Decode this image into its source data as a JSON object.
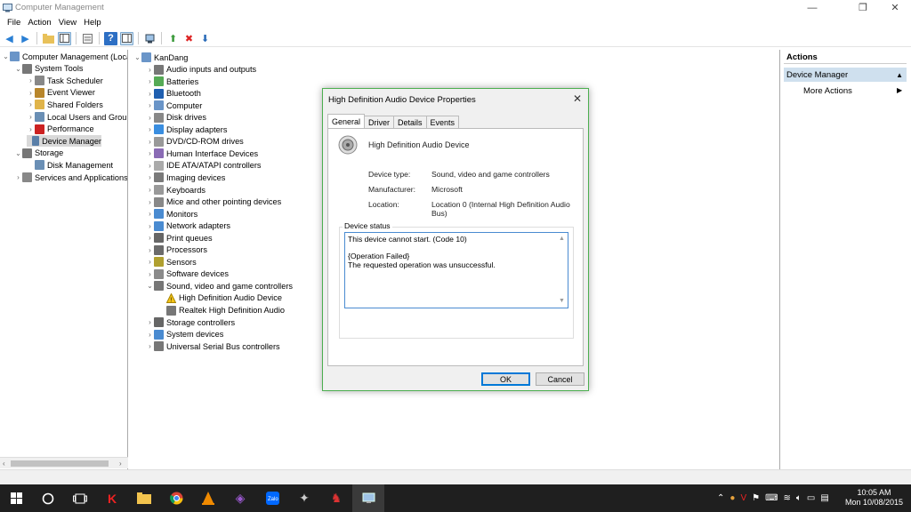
{
  "window": {
    "title": "Computer Management",
    "minimize": "—",
    "restore": "❐",
    "close": "✕"
  },
  "menu": [
    "File",
    "Action",
    "View",
    "Help"
  ],
  "left_tree": [
    {
      "label": "Computer Management (Local",
      "chev": "⌄",
      "level": 0
    },
    {
      "label": "System Tools",
      "chev": "⌄",
      "level": 1
    },
    {
      "label": "Task Scheduler",
      "chev": "›",
      "level": 2
    },
    {
      "label": "Event Viewer",
      "chev": "›",
      "level": 2
    },
    {
      "label": "Shared Folders",
      "chev": "›",
      "level": 2
    },
    {
      "label": "Local Users and Groups",
      "chev": "›",
      "level": 2
    },
    {
      "label": "Performance",
      "chev": "›",
      "level": 2
    },
    {
      "label": "Device Manager",
      "chev": "",
      "level": 2,
      "selected": true
    },
    {
      "label": "Storage",
      "chev": "⌄",
      "level": 1
    },
    {
      "label": "Disk Management",
      "chev": "",
      "level": 2
    },
    {
      "label": "Services and Applications",
      "chev": "›",
      "level": 1
    }
  ],
  "device_tree": {
    "root": "KanDang",
    "items": [
      {
        "label": "Audio inputs and outputs",
        "chev": "›",
        "level": 1
      },
      {
        "label": "Batteries",
        "chev": "›",
        "level": 1
      },
      {
        "label": "Bluetooth",
        "chev": "›",
        "level": 1
      },
      {
        "label": "Computer",
        "chev": "›",
        "level": 1
      },
      {
        "label": "Disk drives",
        "chev": "›",
        "level": 1
      },
      {
        "label": "Display adapters",
        "chev": "›",
        "level": 1
      },
      {
        "label": "DVD/CD-ROM drives",
        "chev": "›",
        "level": 1
      },
      {
        "label": "Human Interface Devices",
        "chev": "›",
        "level": 1
      },
      {
        "label": "IDE ATA/ATAPI controllers",
        "chev": "›",
        "level": 1
      },
      {
        "label": "Imaging devices",
        "chev": "›",
        "level": 1
      },
      {
        "label": "Keyboards",
        "chev": "›",
        "level": 1
      },
      {
        "label": "Mice and other pointing devices",
        "chev": "›",
        "level": 1
      },
      {
        "label": "Monitors",
        "chev": "›",
        "level": 1
      },
      {
        "label": "Network adapters",
        "chev": "›",
        "level": 1
      },
      {
        "label": "Print queues",
        "chev": "›",
        "level": 1
      },
      {
        "label": "Processors",
        "chev": "›",
        "level": 1
      },
      {
        "label": "Sensors",
        "chev": "›",
        "level": 1
      },
      {
        "label": "Software devices",
        "chev": "›",
        "level": 1
      },
      {
        "label": "Sound, video and game controllers",
        "chev": "⌄",
        "level": 1
      },
      {
        "label": "High Definition Audio Device",
        "chev": "",
        "level": 2,
        "warning": true
      },
      {
        "label": "Realtek High Definition Audio",
        "chev": "",
        "level": 2
      },
      {
        "label": "Storage controllers",
        "chev": "›",
        "level": 1
      },
      {
        "label": "System devices",
        "chev": "›",
        "level": 1
      },
      {
        "label": "Universal Serial Bus controllers",
        "chev": "›",
        "level": 1
      }
    ]
  },
  "actions": {
    "header": "Actions",
    "section": "Device Manager",
    "more": "More Actions"
  },
  "dialog": {
    "title": "High Definition Audio Device Properties",
    "tabs": [
      "General",
      "Driver",
      "Details",
      "Events"
    ],
    "active_tab": "General",
    "device_name": "High Definition Audio Device",
    "props": [
      {
        "label": "Device type:",
        "value": "Sound, video and game controllers"
      },
      {
        "label": "Manufacturer:",
        "value": "Microsoft"
      },
      {
        "label": "Location:",
        "value": "Location 0 (Internal High Definition Audio Bus)"
      }
    ],
    "status_label": "Device status",
    "status_lines": [
      "This device cannot start. (Code 10)",
      "",
      "{Operation Failed}",
      "The requested operation was unsuccessful."
    ],
    "ok": "OK",
    "cancel": "Cancel"
  },
  "taskbar": {
    "time": "10:05 AM",
    "date": "Mon 10/08/2015"
  }
}
